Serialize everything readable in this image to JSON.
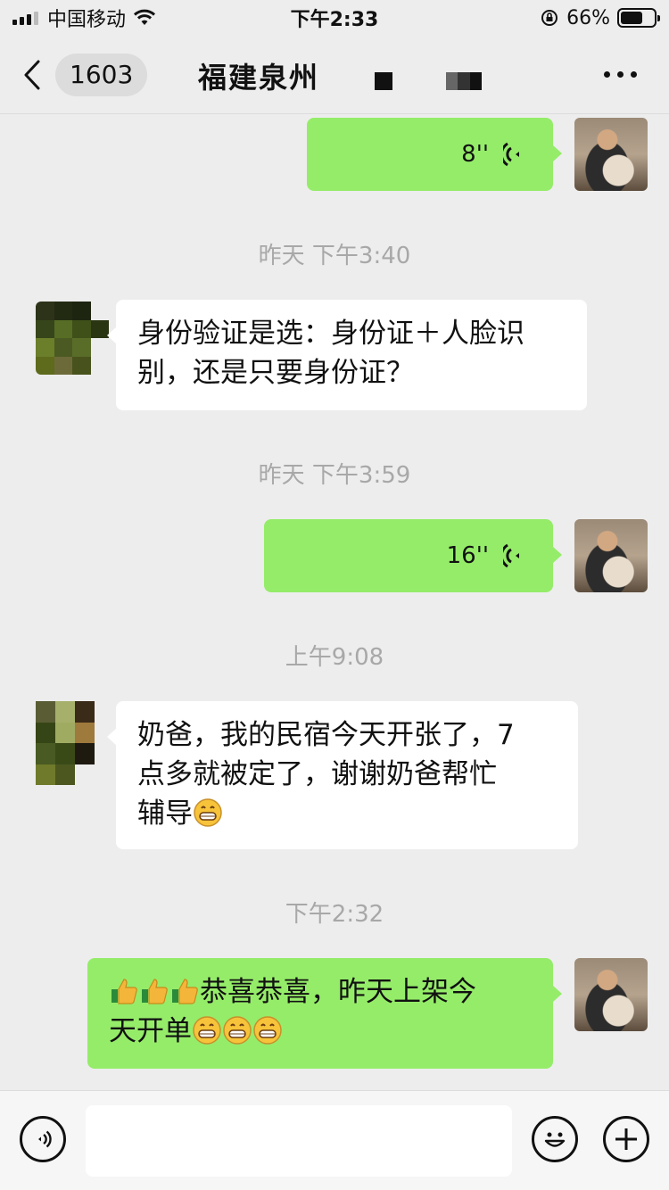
{
  "status_bar": {
    "carrier": "中国移动",
    "time": "下午2:33",
    "battery_percent": "66%",
    "battery_level": 0.66
  },
  "nav": {
    "unread_count": "1603",
    "title": "福建泉州"
  },
  "messages": [
    {
      "type": "voice",
      "sender": "me",
      "duration": "8''"
    },
    {
      "type": "timestamp",
      "text": "昨天 下午3:40"
    },
    {
      "type": "text",
      "sender": "other",
      "lines": [
        "身份验证是选：身份证＋人脸识",
        "别，还是只要身份证？"
      ]
    },
    {
      "type": "timestamp",
      "text": "昨天 下午3:59"
    },
    {
      "type": "voice",
      "sender": "me",
      "duration": "16''"
    },
    {
      "type": "timestamp",
      "text": "上午9:08"
    },
    {
      "type": "text",
      "sender": "other",
      "lines": [
        "奶爸，我的民宿今天开张了，7",
        "点多就被定了，谢谢奶爸帮忙",
        "辅导"
      ],
      "trailing_emoji": "grin-emoji"
    },
    {
      "type": "timestamp",
      "text": "下午2:32"
    },
    {
      "type": "text",
      "sender": "me",
      "lines": [
        "恭喜恭喜，昨天上架今",
        "天开单"
      ],
      "leading_emoji": [
        "thumbs-up-emoji",
        "thumbs-up-emoji",
        "thumbs-up-emoji"
      ],
      "trailing_emoji": [
        "grin-emoji",
        "grin-emoji",
        "grin-emoji"
      ]
    }
  ],
  "colors": {
    "background": "#ededed",
    "my_bubble": "#95ec69",
    "other_bubble": "#ffffff",
    "timestamp_text": "#a8a8a8"
  },
  "icons": {
    "back": "chevron-left-icon",
    "more": "more-dots-icon",
    "voice_input": "voice-input-icon",
    "emoji_picker": "smiley-icon",
    "add": "plus-icon",
    "voice_wave": "voice-wave-icon"
  }
}
